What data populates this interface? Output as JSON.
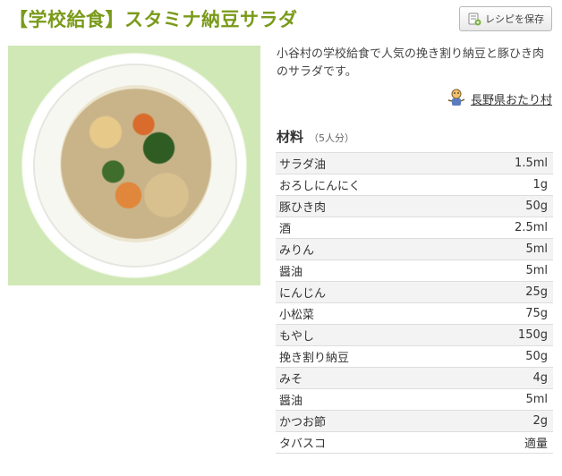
{
  "recipe": {
    "title": "【学校給食】スタミナ納豆サラダ",
    "save_label": "レシピを保存",
    "description": "小谷村の学校給食で人気の挽き割り納豆と豚ひき肉のサラダです。",
    "author": "長野県おたり村",
    "ingredients_heading": "材料",
    "servings": "（5人分）",
    "ingredients": [
      {
        "name": "サラダ油",
        "amount": "1.5ml"
      },
      {
        "name": "おろしにんにく",
        "amount": "1g"
      },
      {
        "name": "豚ひき肉",
        "amount": "50g"
      },
      {
        "name": "酒",
        "amount": "2.5ml"
      },
      {
        "name": "みりん",
        "amount": "5ml"
      },
      {
        "name": "醤油",
        "amount": "5ml"
      },
      {
        "name": "にんじん",
        "amount": "25g"
      },
      {
        "name": "小松菜",
        "amount": "75g"
      },
      {
        "name": "もやし",
        "amount": "150g"
      },
      {
        "name": "挽き割り納豆",
        "amount": "50g"
      },
      {
        "name": "みそ",
        "amount": "4g"
      },
      {
        "name": "醤油",
        "amount": "5ml"
      },
      {
        "name": "かつお節",
        "amount": "2g"
      },
      {
        "name": "タバスコ",
        "amount": "適量"
      }
    ]
  },
  "colors": {
    "title": "#7a9a1a",
    "row_shade": "#f3f3f3"
  },
  "icons": {
    "save": "recipe-save-icon",
    "author": "mascot-icon"
  }
}
